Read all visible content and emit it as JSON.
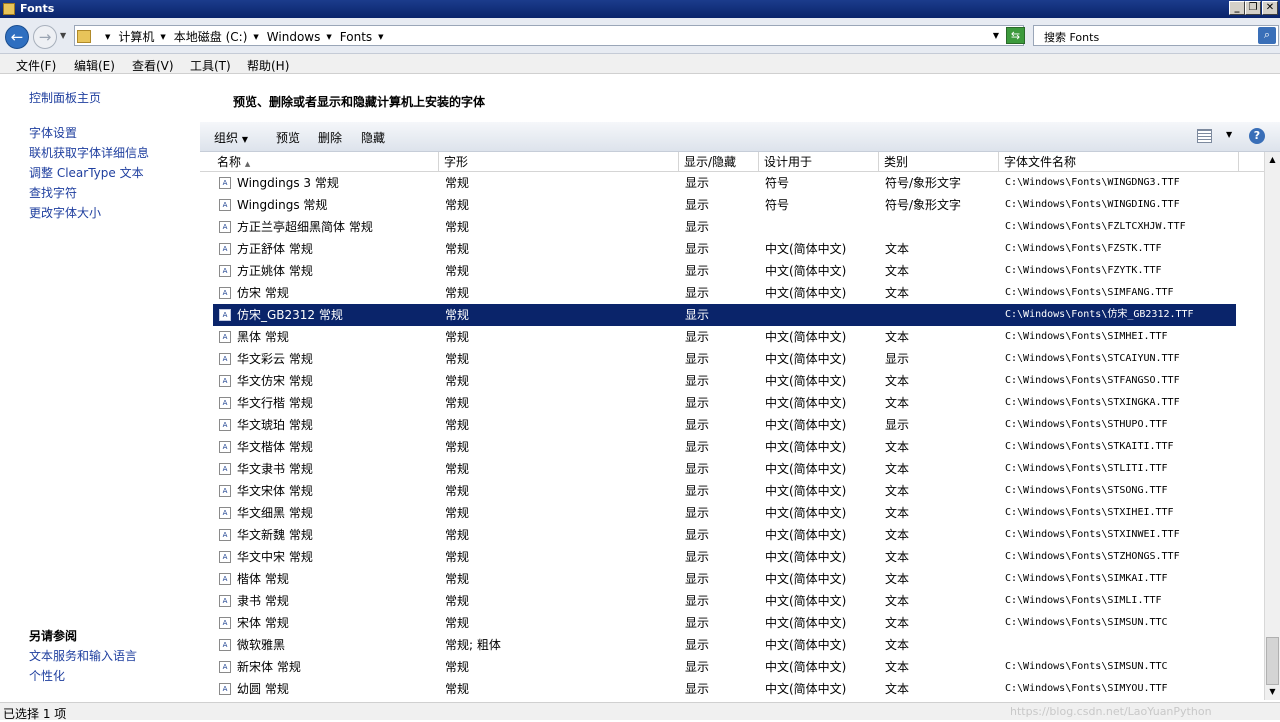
{
  "window": {
    "title": "Fonts"
  },
  "address": {
    "crumbs": [
      "计算机",
      "本地磁盘 (C:)",
      "Windows",
      "Fonts"
    ],
    "search_placeholder": "搜索 Fonts"
  },
  "menu": [
    "文件(F)",
    "编辑(E)",
    "查看(V)",
    "工具(T)",
    "帮助(H)"
  ],
  "sidebar": {
    "home": "控制面板主页",
    "links": [
      "字体设置",
      "联机获取字体详细信息",
      "调整 ClearType 文本",
      "查找字符",
      "更改字体大小"
    ],
    "see_also": "另请参阅",
    "see_also_links": [
      "文本服务和输入语言",
      "个性化"
    ]
  },
  "heading": "预览、删除或者显示和隐藏计算机上安装的字体",
  "toolbar": {
    "organize": "组织",
    "preview": "预览",
    "delete": "删除",
    "hide": "隐藏"
  },
  "columns": [
    "名称",
    "字形",
    "显示/隐藏",
    "设计用于",
    "类别",
    "字体文件名称"
  ],
  "rows": [
    {
      "name": "Wingdings 3 常规",
      "style": "常规",
      "show": "显示",
      "design": "符号",
      "cat": "符号/象形文字",
      "file": "C:\\Windows\\Fonts\\WINGDNG3.TTF"
    },
    {
      "name": "Wingdings 常规",
      "style": "常规",
      "show": "显示",
      "design": "符号",
      "cat": "符号/象形文字",
      "file": "C:\\Windows\\Fonts\\WINGDING.TTF"
    },
    {
      "name": "方正兰亭超细黑简体 常规",
      "style": "常规",
      "show": "显示",
      "design": "",
      "cat": "",
      "file": "C:\\Windows\\Fonts\\FZLTCXHJW.TTF"
    },
    {
      "name": "方正舒体 常规",
      "style": "常规",
      "show": "显示",
      "design": "中文(简体中文)",
      "cat": "文本",
      "file": "C:\\Windows\\Fonts\\FZSTK.TTF"
    },
    {
      "name": "方正姚体 常规",
      "style": "常规",
      "show": "显示",
      "design": "中文(简体中文)",
      "cat": "文本",
      "file": "C:\\Windows\\Fonts\\FZYTK.TTF"
    },
    {
      "name": "仿宋 常规",
      "style": "常规",
      "show": "显示",
      "design": "中文(简体中文)",
      "cat": "文本",
      "file": "C:\\Windows\\Fonts\\SIMFANG.TTF"
    },
    {
      "name": "仿宋_GB2312 常规",
      "style": "常规",
      "show": "显示",
      "design": "",
      "cat": "",
      "file": "C:\\Windows\\Fonts\\仿宋_GB2312.TTF",
      "selected": true
    },
    {
      "name": "黑体 常规",
      "style": "常规",
      "show": "显示",
      "design": "中文(简体中文)",
      "cat": "文本",
      "file": "C:\\Windows\\Fonts\\SIMHEI.TTF"
    },
    {
      "name": "华文彩云 常规",
      "style": "常规",
      "show": "显示",
      "design": "中文(简体中文)",
      "cat": "显示",
      "file": "C:\\Windows\\Fonts\\STCAIYUN.TTF"
    },
    {
      "name": "华文仿宋 常规",
      "style": "常规",
      "show": "显示",
      "design": "中文(简体中文)",
      "cat": "文本",
      "file": "C:\\Windows\\Fonts\\STFANGSO.TTF"
    },
    {
      "name": "华文行楷 常规",
      "style": "常规",
      "show": "显示",
      "design": "中文(简体中文)",
      "cat": "文本",
      "file": "C:\\Windows\\Fonts\\STXINGKA.TTF"
    },
    {
      "name": "华文琥珀 常规",
      "style": "常规",
      "show": "显示",
      "design": "中文(简体中文)",
      "cat": "显示",
      "file": "C:\\Windows\\Fonts\\STHUPO.TTF"
    },
    {
      "name": "华文楷体 常规",
      "style": "常规",
      "show": "显示",
      "design": "中文(简体中文)",
      "cat": "文本",
      "file": "C:\\Windows\\Fonts\\STKAITI.TTF"
    },
    {
      "name": "华文隶书 常规",
      "style": "常规",
      "show": "显示",
      "design": "中文(简体中文)",
      "cat": "文本",
      "file": "C:\\Windows\\Fonts\\STLITI.TTF"
    },
    {
      "name": "华文宋体 常规",
      "style": "常规",
      "show": "显示",
      "design": "中文(简体中文)",
      "cat": "文本",
      "file": "C:\\Windows\\Fonts\\STSONG.TTF"
    },
    {
      "name": "华文细黑 常规",
      "style": "常规",
      "show": "显示",
      "design": "中文(简体中文)",
      "cat": "文本",
      "file": "C:\\Windows\\Fonts\\STXIHEI.TTF"
    },
    {
      "name": "华文新魏 常规",
      "style": "常规",
      "show": "显示",
      "design": "中文(简体中文)",
      "cat": "文本",
      "file": "C:\\Windows\\Fonts\\STXINWEI.TTF"
    },
    {
      "name": "华文中宋 常规",
      "style": "常规",
      "show": "显示",
      "design": "中文(简体中文)",
      "cat": "文本",
      "file": "C:\\Windows\\Fonts\\STZHONGS.TTF"
    },
    {
      "name": "楷体 常规",
      "style": "常规",
      "show": "显示",
      "design": "中文(简体中文)",
      "cat": "文本",
      "file": "C:\\Windows\\Fonts\\SIMKAI.TTF"
    },
    {
      "name": "隶书 常规",
      "style": "常规",
      "show": "显示",
      "design": "中文(简体中文)",
      "cat": "文本",
      "file": "C:\\Windows\\Fonts\\SIMLI.TTF"
    },
    {
      "name": "宋体 常规",
      "style": "常规",
      "show": "显示",
      "design": "中文(简体中文)",
      "cat": "文本",
      "file": "C:\\Windows\\Fonts\\SIMSUN.TTC"
    },
    {
      "name": "微软雅黑",
      "style": "常规; 粗体",
      "show": "显示",
      "design": "中文(简体中文)",
      "cat": "文本",
      "file": ""
    },
    {
      "name": "新宋体 常规",
      "style": "常规",
      "show": "显示",
      "design": "中文(简体中文)",
      "cat": "文本",
      "file": "C:\\Windows\\Fonts\\SIMSUN.TTC"
    },
    {
      "name": "幼圆 常规",
      "style": "常规",
      "show": "显示",
      "design": "中文(简体中文)",
      "cat": "文本",
      "file": "C:\\Windows\\Fonts\\SIMYOU.TTF"
    }
  ],
  "status": "已选择 1 项",
  "watermark": "https://blog.csdn.net/LaoYuanPython"
}
